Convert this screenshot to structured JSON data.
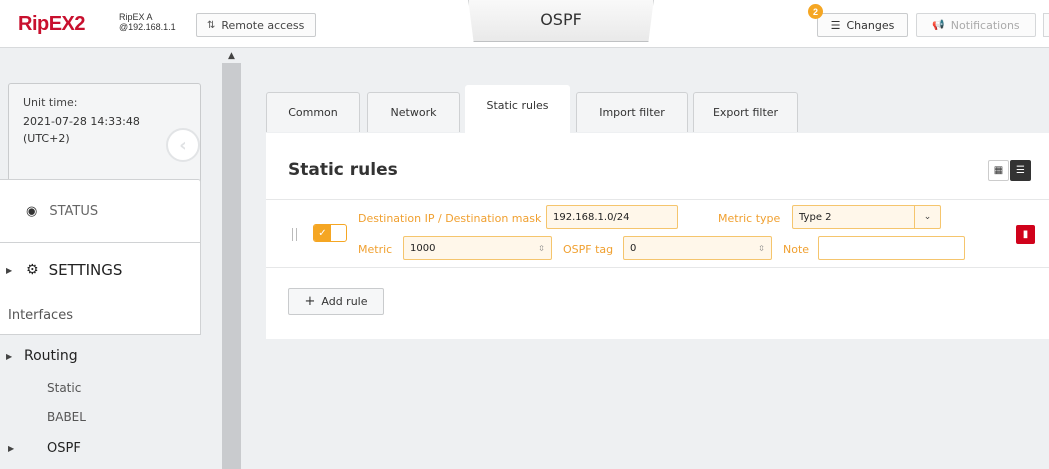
{
  "header": {
    "logo_text": "RipEX2",
    "unit_name": "RipEX A",
    "unit_ip": "@192.168.1.1",
    "remote_access_label": "Remote access",
    "page_title": "OSPF",
    "changes_count": "2",
    "changes_label": "Changes",
    "notifications_label": "Notifications"
  },
  "sidebar": {
    "unit_time_label": "Unit time:",
    "unit_time_value": "2021-07-28 14:33:48",
    "unit_time_zone": "(UTC+2)",
    "status_label": "STATUS",
    "settings_label": "SETTINGS",
    "interfaces_label": "Interfaces",
    "routing_label": "Routing",
    "routing_items": [
      "Static",
      "BABEL",
      "OSPF"
    ]
  },
  "tabs": [
    "Common",
    "Network",
    "Static rules",
    "Import filter",
    "Export filter"
  ],
  "active_tab": "Static rules",
  "panel": {
    "title": "Static rules",
    "rule": {
      "enabled": true,
      "dest_label": "Destination IP / Destination mask",
      "dest_value": "192.168.1.0/24",
      "metric_type_label": "Metric type",
      "metric_type_value": "Type 2",
      "metric_label": "Metric",
      "metric_value": "1000",
      "ospf_tag_label": "OSPF tag",
      "ospf_tag_value": "0",
      "note_label": "Note",
      "note_value": ""
    },
    "add_rule_label": "Add rule"
  },
  "colors": {
    "brand": "#c8102e",
    "accent": "#f5a623",
    "danger": "#d0021b"
  }
}
